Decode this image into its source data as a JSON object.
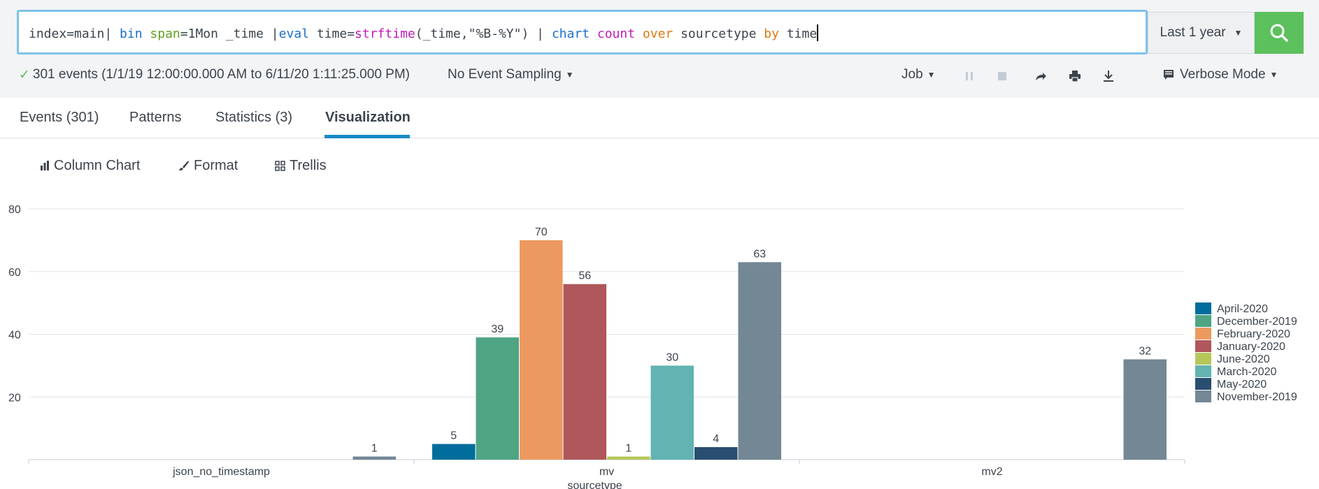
{
  "search": {
    "query_tokens": [
      {
        "t": "index=main| ",
        "c": ""
      },
      {
        "t": "bin",
        "c": "tok-cmd"
      },
      {
        "t": " ",
        "c": ""
      },
      {
        "t": "span",
        "c": "tok-arg"
      },
      {
        "t": "=1Mon _time |",
        "c": ""
      },
      {
        "t": "eval",
        "c": "tok-cmd"
      },
      {
        "t": " time=",
        "c": ""
      },
      {
        "t": "strftime",
        "c": "tok-fn"
      },
      {
        "t": "(_time,\"%B-%Y\") | ",
        "c": ""
      },
      {
        "t": "chart",
        "c": "tok-cmd"
      },
      {
        "t": " ",
        "c": ""
      },
      {
        "t": "count",
        "c": "tok-fn"
      },
      {
        "t": " ",
        "c": ""
      },
      {
        "t": "over",
        "c": "tok-kw"
      },
      {
        "t": " sourcetype ",
        "c": ""
      },
      {
        "t": "by",
        "c": "tok-kw"
      },
      {
        "t": " time",
        "c": ""
      }
    ],
    "time_range": "Last 1 year",
    "search_icon": "search-icon"
  },
  "status": {
    "events_summary": "301 events (1/1/19 12:00:00.000 AM to 6/11/20 1:11:25.000 PM)",
    "sampling": "No Event Sampling",
    "job": "Job",
    "mode": "Verbose Mode"
  },
  "tabs": {
    "events": "Events (301)",
    "patterns": "Patterns",
    "statistics": "Statistics (3)",
    "visualization": "Visualization"
  },
  "vizbar": {
    "chart_type": "Column Chart",
    "format": "Format",
    "trellis": "Trellis"
  },
  "colors": {
    "April-2020": "#006d9c",
    "December-2019": "#4fa484",
    "February-2020": "#ec9960",
    "January-2020": "#af575a",
    "June-2020": "#b6c75a",
    "March-2020": "#62b3b2",
    "May-2020": "#294e70",
    "November-2019": "#738795"
  },
  "chart_data": {
    "type": "bar",
    "xlabel": "sourcetype",
    "ylabel": "",
    "ylim": [
      0,
      80
    ],
    "yticks": [
      20,
      40,
      60,
      80
    ],
    "categories": [
      "json_no_timestamp",
      "mv",
      "mv2"
    ],
    "series": [
      {
        "name": "April-2020",
        "values": [
          0,
          5,
          0
        ]
      },
      {
        "name": "December-2019",
        "values": [
          0,
          39,
          0
        ]
      },
      {
        "name": "February-2020",
        "values": [
          0,
          70,
          0
        ]
      },
      {
        "name": "January-2020",
        "values": [
          0,
          56,
          0
        ]
      },
      {
        "name": "June-2020",
        "values": [
          0,
          1,
          0
        ]
      },
      {
        "name": "March-2020",
        "values": [
          0,
          30,
          0
        ]
      },
      {
        "name": "May-2020",
        "values": [
          0,
          4,
          0
        ]
      },
      {
        "name": "November-2019",
        "values": [
          1,
          63,
          32
        ]
      }
    ],
    "legend_position": "right",
    "grid": true,
    "data_labels": true
  }
}
